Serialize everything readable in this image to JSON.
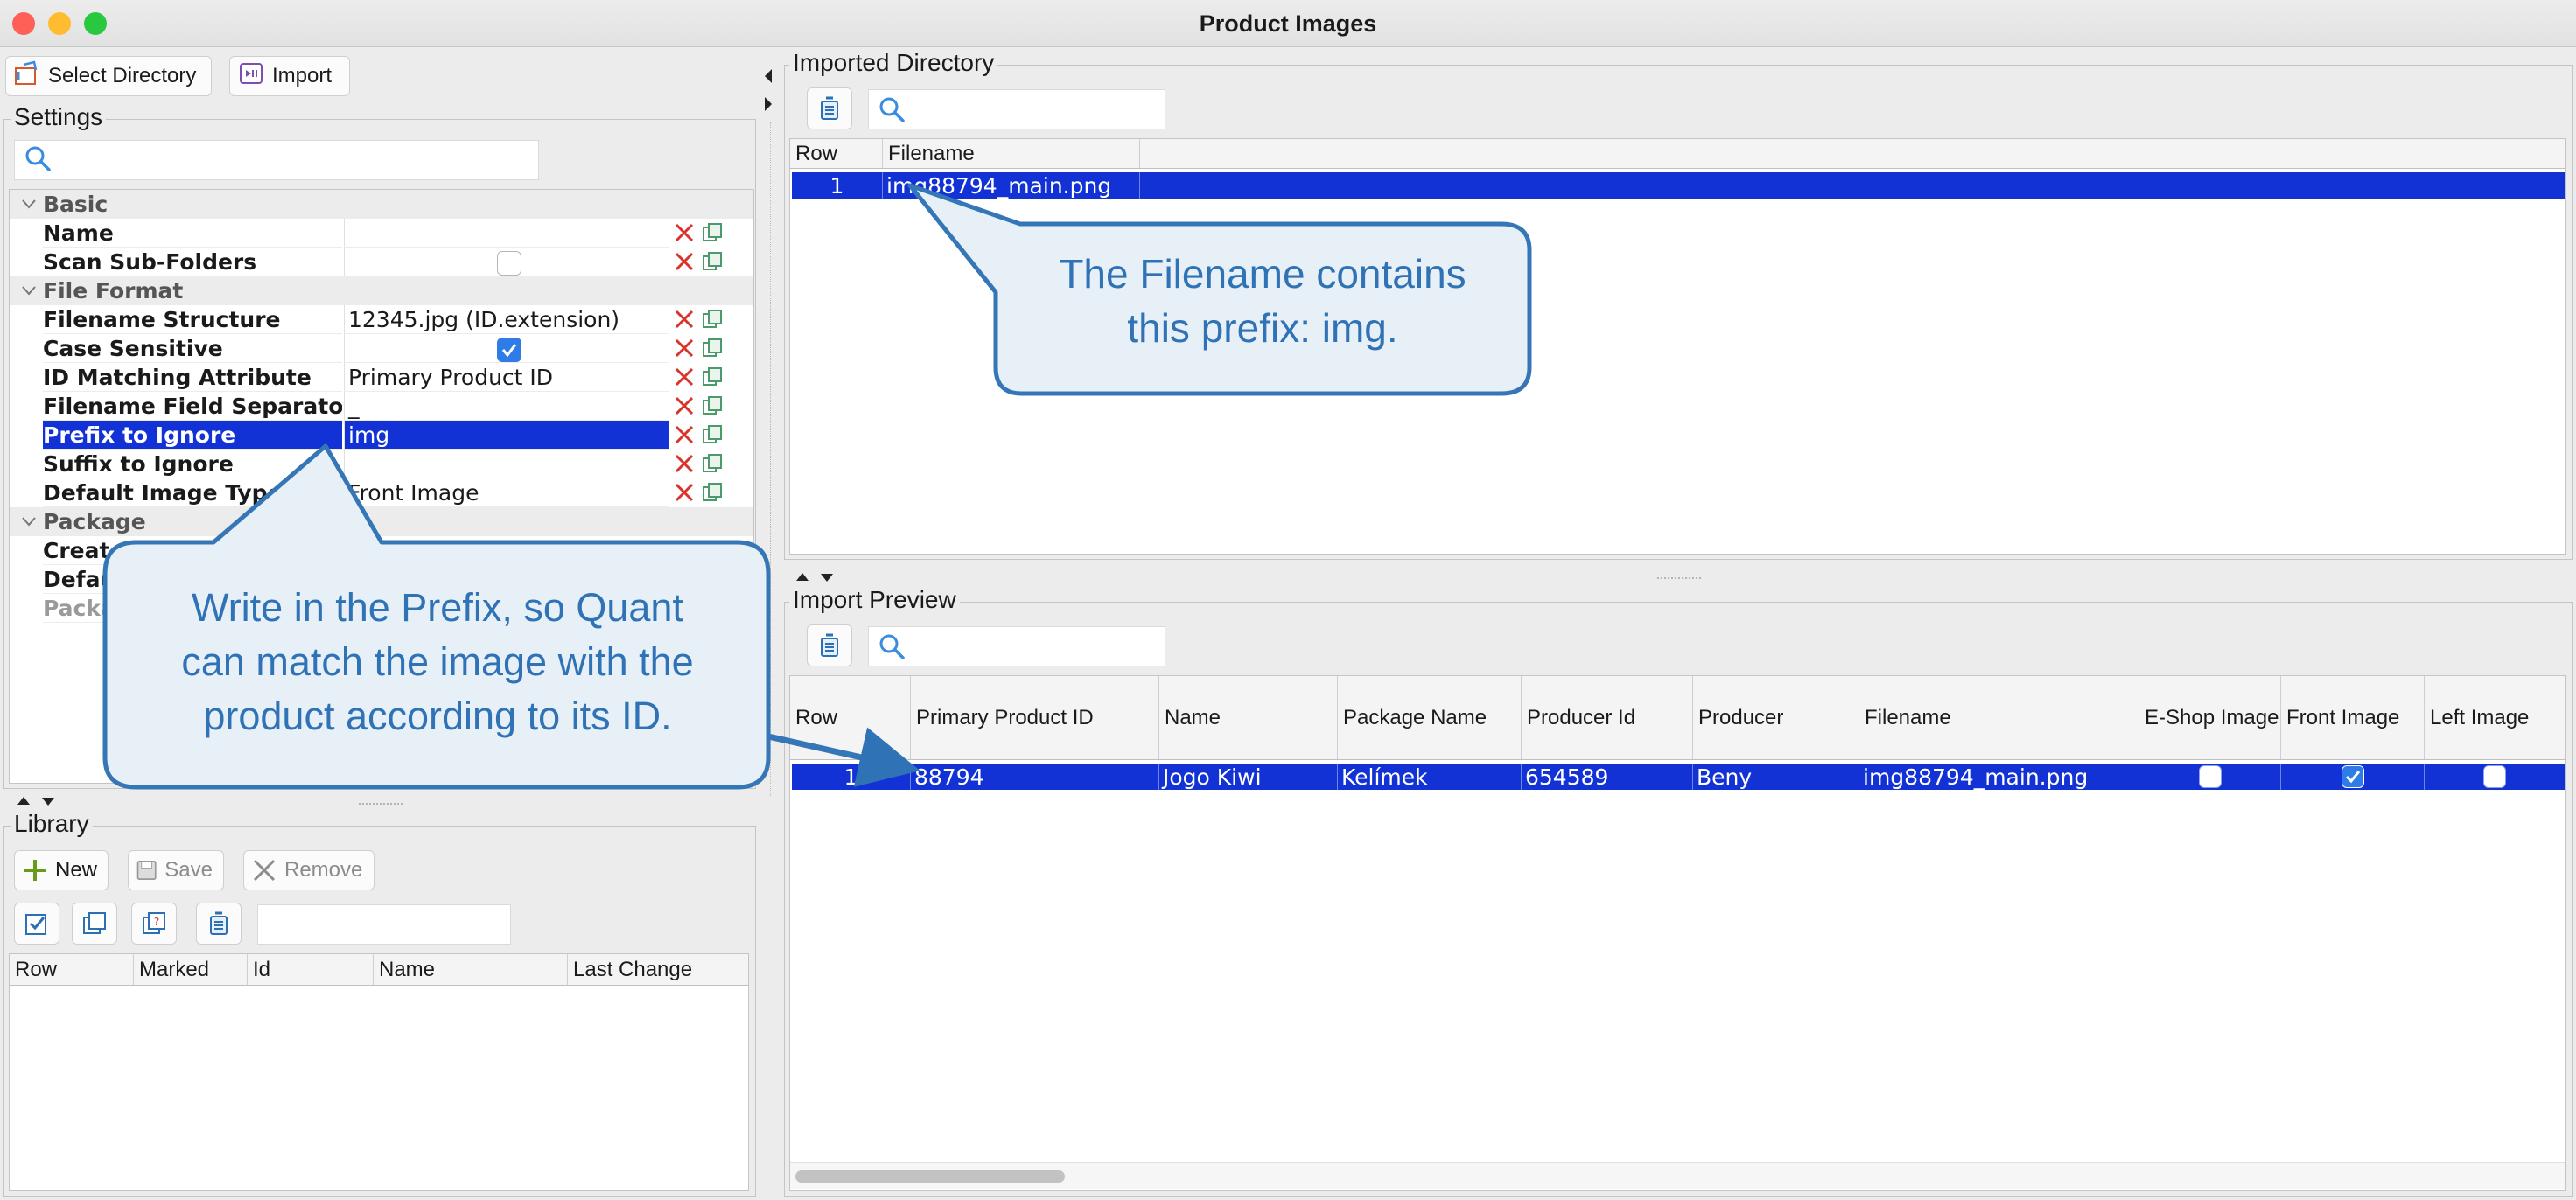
{
  "window": {
    "title": "Product Images",
    "controls": {
      "close_color": "#fe5f57",
      "minimize_color": "#febc2e",
      "zoom_color": "#28c840"
    }
  },
  "toolbar": {
    "select_directory": "Select Directory",
    "import": "Import"
  },
  "settings": {
    "legend": "Settings",
    "search_placeholder": "",
    "categories": {
      "basic": "Basic",
      "file_format": "File Format",
      "package": "Package"
    },
    "rows": {
      "name": {
        "label": "Name",
        "value": ""
      },
      "scan": {
        "label": "Scan Sub-Folders",
        "checked": false
      },
      "structure": {
        "label": "Filename Structure",
        "value": "12345.jpg (ID.extension)"
      },
      "case": {
        "label": "Case Sensitive",
        "checked": true
      },
      "id_attr": {
        "label": "ID Matching Attribute",
        "value": "Primary Product ID"
      },
      "separator": {
        "label": "Filename Field Separator",
        "value": "_"
      },
      "prefix": {
        "label": "Prefix to Ignore",
        "value": "img"
      },
      "suffix": {
        "label": "Suffix to Ignore",
        "value": ""
      },
      "default_type": {
        "label": "Default Image Type",
        "value": "Front Image"
      },
      "create": {
        "label": "Create"
      },
      "defau": {
        "label": "Defau"
      },
      "packa": {
        "label": "Packa"
      }
    }
  },
  "library": {
    "legend": "Library",
    "new": "New",
    "save": "Save",
    "remove": "Remove",
    "columns": [
      "Row",
      "Marked",
      "Id",
      "Name",
      "Last Change"
    ]
  },
  "imported_directory": {
    "legend": "Imported Directory",
    "columns": [
      "Row",
      "Filename"
    ],
    "rows": [
      {
        "row": "1",
        "filename": "img88794_main.png"
      }
    ]
  },
  "import_preview": {
    "legend": "Import Preview",
    "columns": [
      "Row",
      "Primary Product ID",
      "Name",
      "Package Name",
      "Producer Id",
      "Producer",
      "Filename",
      "E-Shop Image",
      "Front Image",
      "Left Image"
    ],
    "rows": [
      {
        "row": "1",
        "primary_id": "88794",
        "name": "Jogo Kiwi",
        "package": "Kelímek",
        "producer_id": "654589",
        "producer": "Beny",
        "filename": "img88794_main.png",
        "eshop": false,
        "front": true,
        "left": false
      }
    ]
  },
  "callouts": {
    "top_line1": "The Filename contains",
    "top_line2": "this prefix: img.",
    "left_line1": "Write in the Prefix, so Quant",
    "left_line2": "can match the image with the",
    "left_line3": "product according to its ID."
  },
  "icons": {
    "select_directory": "folder-select-icon",
    "import": "import-icon",
    "search": "magnifier-icon",
    "delete": "red-x-icon",
    "copy": "copy-icon"
  }
}
